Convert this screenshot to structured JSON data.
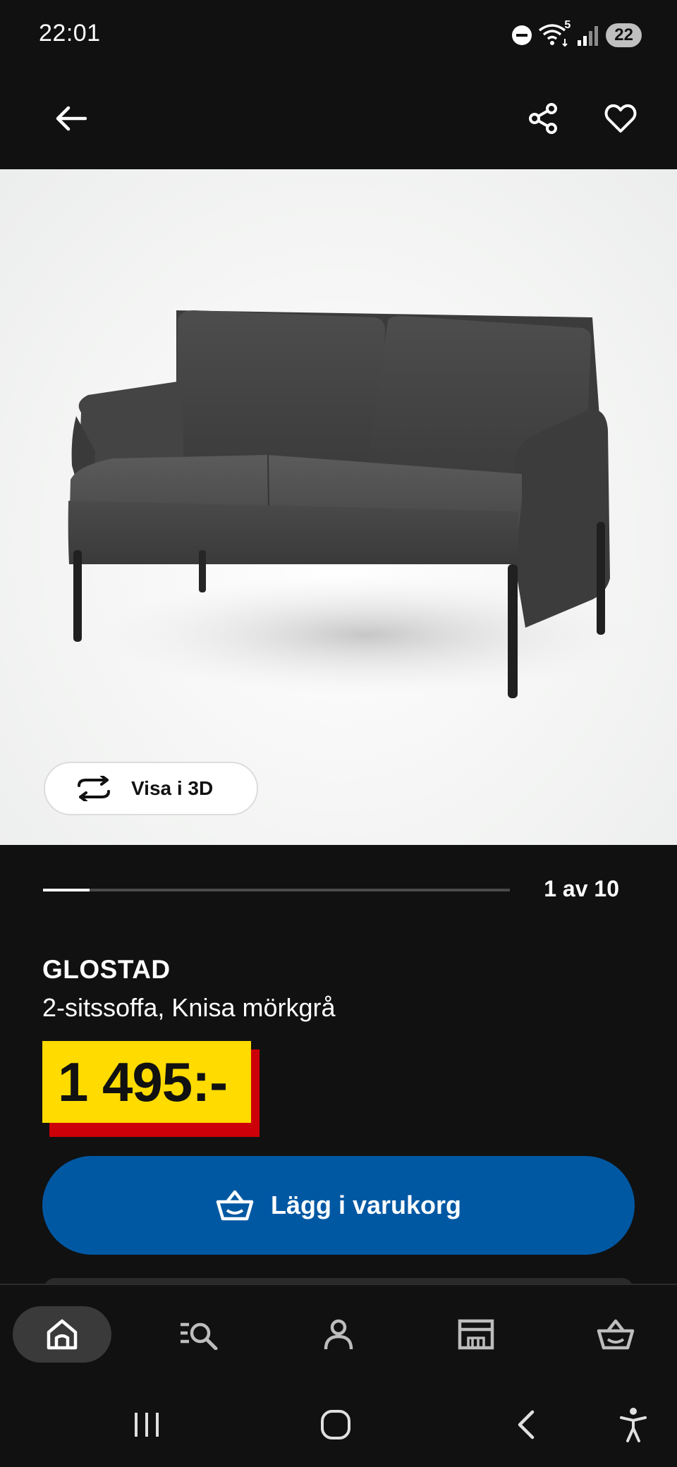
{
  "status_bar": {
    "time": "22:01",
    "icons": [
      "do-not-disturb-icon",
      "wifi-icon",
      "signal-icon"
    ],
    "wifi_badge": "5",
    "battery": "22"
  },
  "header": {
    "back_icon": "back-arrow-icon",
    "share_icon": "share-icon",
    "favorite_icon": "heart-icon"
  },
  "product_image": {
    "subject": "sofa"
  },
  "view_3d": {
    "label": "Visa i 3D",
    "icon": "rotate-icon"
  },
  "carousel": {
    "counter": "1 av 10",
    "progress": 0.1
  },
  "product": {
    "name": "GLOSTAD",
    "description": "2-sitssoffa, Knisa mörkgrå",
    "price": "1 495:-"
  },
  "add_to_cart": {
    "label": "Lägg i varukorg",
    "icon": "basket-icon"
  },
  "bottom_nav": {
    "items": [
      {
        "icon": "home-icon",
        "active": true
      },
      {
        "icon": "search-list-icon",
        "active": false
      },
      {
        "icon": "profile-icon",
        "active": false
      },
      {
        "icon": "store-icon",
        "active": false
      },
      {
        "icon": "basket-icon",
        "active": false
      }
    ]
  },
  "system_nav": {
    "items": [
      "recents-icon",
      "home-circle-icon",
      "back-chevron-icon",
      "accessibility-icon"
    ]
  },
  "colors": {
    "background": "#111111",
    "price_yellow": "#ffdb00",
    "price_red": "#cc0008",
    "primary_blue": "#0058a3"
  }
}
